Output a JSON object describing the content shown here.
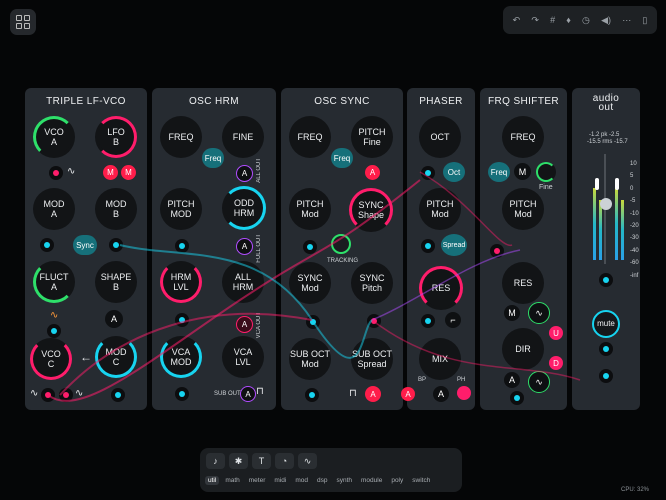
{
  "app": {
    "menu_icon": "grid-icon",
    "cpu": "CPU: 32%"
  },
  "toolbar": {
    "items": [
      {
        "name": "undo-icon",
        "glyph": "↶"
      },
      {
        "name": "redo-icon",
        "glyph": "↷"
      },
      {
        "name": "hash-icon",
        "glyph": "#"
      },
      {
        "name": "bulb-icon",
        "glyph": "♦"
      },
      {
        "name": "clock-icon",
        "glyph": "◷"
      },
      {
        "name": "speaker-icon",
        "glyph": "◀)"
      },
      {
        "name": "dots-icon",
        "glyph": "⋯"
      },
      {
        "name": "sidebar-icon",
        "glyph": "▯"
      }
    ]
  },
  "panels": {
    "lfvco": {
      "title": "TRIPLE LF-VCO",
      "vco_a": "VCO",
      "vco_a2": "A",
      "lfo_b": "LFO",
      "lfo_b2": "B",
      "mod_a": "MOD",
      "mod_a2": "A",
      "mod_b": "MOD",
      "mod_b2": "B",
      "sync": "Sync",
      "fluct": "FLUCT",
      "fluct2": "A",
      "shape": "SHAPE",
      "shape2": "B",
      "a_btn": "A",
      "vco_c": "VCO",
      "vco_c2": "C",
      "mod_c": "MOD",
      "mod_c2": "C",
      "m1": "M",
      "m2": "M",
      "arrow": "←"
    },
    "oschrm": {
      "title": "OSC HRM",
      "freq": "FREQ",
      "fine": "FINE",
      "freq_btn": "Freq",
      "pitch_mod": "PITCH",
      "pitch_mod2": "MOD",
      "odd_hrm": "ODD",
      "odd_hrm2": "HRM",
      "hrm_lvl": "HRM",
      "hrm_lvl2": "LVL",
      "all_hrm": "ALL",
      "all_hrm2": "HRM",
      "vca_mod": "VCA",
      "vca_mod2": "MOD",
      "vca_lvl": "VCA",
      "vca_lvl2": "LVL",
      "all_out": "ALL OUT",
      "full_out": "FULL OUT",
      "vca_out": "VCA OUT",
      "sub_out": "SUB OUT",
      "a1": "A",
      "a2": "A",
      "a3": "A"
    },
    "oscsync": {
      "title": "OSC SYNC",
      "freq": "FREQ",
      "pitch_fine": "PITCH",
      "pitch_fine2": "Fine",
      "freq_btn": "Freq",
      "a1": "A",
      "pitch_mod": "PITCH",
      "pitch_mod2": "Mod",
      "sync_shape": "SYNC",
      "sync_shape2": "Shape",
      "tracking": "TRACKING",
      "sync_mod": "SYNC",
      "sync_mod2": "Mod",
      "sync_pitch": "SYNC",
      "sync_pitch2": "Pitch",
      "sub_mod": "SUB OCT",
      "sub_mod2": "Mod",
      "sub_spread": "SUB OCT",
      "sub_spread2": "Spread",
      "a2": "A"
    },
    "phaser": {
      "title": "PHASER",
      "oct": "OCT",
      "oct_btn": "Oct",
      "pitch_mod": "PITCH",
      "pitch_mod2": "Mod",
      "spread": "Spread",
      "res": "RES",
      "mix": "MIX",
      "bp": "BP",
      "ph": "PH",
      "a1": "A",
      "a2": "A"
    },
    "frqshifter": {
      "title": "FRQ SHIFTER",
      "freq": "FREQ",
      "freq_btn": "Freq",
      "m": "M",
      "fine": "Fine",
      "pitch_mod": "PITCH",
      "pitch_mod2": "Mod",
      "res": "RES",
      "m2": "M",
      "dir": "DIR",
      "u": "U",
      "d": "D",
      "a": "A"
    },
    "audioout": {
      "title1": "audio",
      "title2": "out",
      "pk_l": "-1.2",
      "pk": "pk",
      "pk_r": "-2.5",
      "rms_l": "-15.5",
      "rms": "rms",
      "rms_r": "-15.7",
      "scale": [
        "10",
        "5",
        "0",
        "-5",
        "-10",
        "-20",
        "-30",
        "-40",
        "-60",
        "-inf"
      ],
      "mute": "mute"
    }
  },
  "dock": {
    "icons": [
      {
        "name": "mic-icon",
        "glyph": "♪"
      },
      {
        "name": "gear-icon",
        "glyph": "✱"
      },
      {
        "name": "text-icon",
        "glyph": "T"
      },
      {
        "name": "timer-icon",
        "glyph": "◔"
      },
      {
        "name": "wave-icon",
        "glyph": "∿"
      }
    ],
    "categories": [
      "util",
      "math",
      "meter",
      "midi",
      "mod",
      "dsp",
      "synth",
      "module",
      "poly",
      "switch"
    ]
  },
  "colors": {
    "cyan": "#17d4f0",
    "pink": "#ff1d6b",
    "panel": "#262b31",
    "teal": "#16707a"
  }
}
